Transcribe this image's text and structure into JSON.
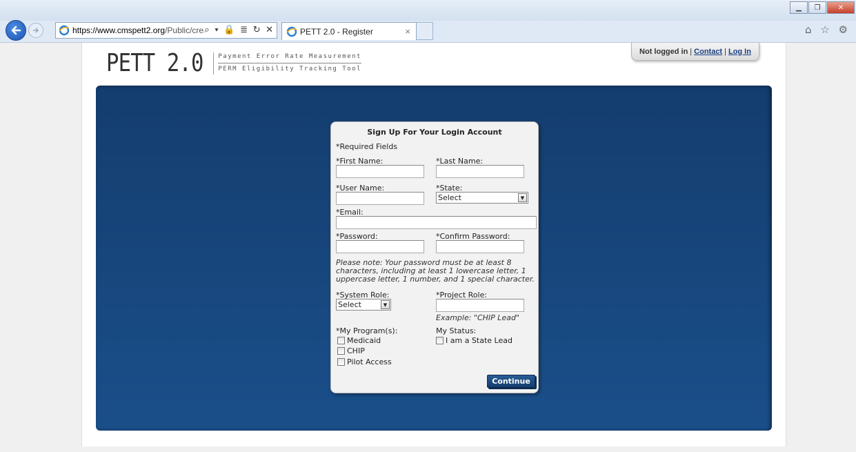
{
  "browser": {
    "url_host": "https://www.cmspett2.org",
    "url_rest": "/Public/creat",
    "address_tools": "⌕ ▾ 🔒 ≣ ↻ ✕",
    "tab_title": "PETT 2.0 - Register",
    "tab_close": "×",
    "right_icons": "⌂ ☆ ⚙"
  },
  "header": {
    "logo_main": "PETT 2.0",
    "logo_line1": "Payment Error Rate Measurement",
    "logo_line2": "PERM Eligibility Tracking Tool",
    "status_text": "Not logged in",
    "pipe": "|",
    "contact_link": "Contact",
    "login_link": "Log In"
  },
  "form": {
    "title": "Sign Up For Your Login Account",
    "required_note": "*Required Fields",
    "first_name_label": "*First Name:",
    "last_name_label": "*Last Name:",
    "user_name_label": "*User Name:",
    "state_label": "*State:",
    "state_value": "Select",
    "email_label": "*Email:",
    "password_label": "*Password:",
    "confirm_password_label": "*Confirm Password:",
    "password_note": "Please note: Your password must be at least 8 characters, including at least 1 lowercase letter, 1 uppercase letter, 1 number, and 1 special character.",
    "system_role_label": "*System Role:",
    "system_role_value": "Select",
    "project_role_label": "*Project Role:",
    "project_role_example": "Example: \"CHIP Lead\"",
    "programs_label": "*My Program(s):",
    "programs": [
      "Medicaid",
      "CHIP",
      "Pilot Access"
    ],
    "status_label": "My Status:",
    "state_lead_label": "I am a State Lead",
    "continue_label": "Continue"
  }
}
